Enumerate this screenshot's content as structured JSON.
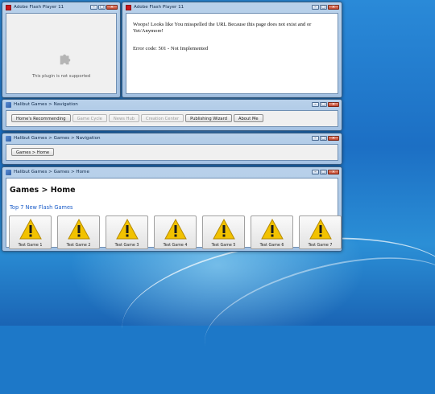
{
  "windows": {
    "flash_left": {
      "title": "Adobe Flash Player 11",
      "message": "This plugin is not supported"
    },
    "flash_right": {
      "title": "Adobe Flash Player 11",
      "message": "Woops! Looks like You misspelled the URL Because this page does not exist and or Yet/Anymore!",
      "error_code": "Error code: 501 - Not Implemented"
    },
    "navigation": {
      "title": "Halibut Games > Navigation",
      "buttons": [
        {
          "label": "Home's Recommending",
          "enabled": true
        },
        {
          "label": "Game Cycle",
          "enabled": false
        },
        {
          "label": "News Hub",
          "enabled": false
        },
        {
          "label": "Creation Center",
          "enabled": false
        },
        {
          "label": "Publishing Wizard",
          "enabled": true
        },
        {
          "label": "About Me",
          "enabled": true
        }
      ]
    },
    "games_navigation": {
      "title": "Halibut Games > Games > Navigation",
      "buttons": [
        {
          "label": "Games > Home"
        }
      ]
    },
    "games_home": {
      "title": "Halibut Games > Games > Home",
      "heading": "Games > Home",
      "subheading": "Top 7 New Flash Games",
      "games": [
        "Test Game 1",
        "Test Game 2",
        "Test Game 3",
        "Test Game 4",
        "Test Game 5",
        "Test Game 6",
        "Test Game 7"
      ]
    }
  },
  "icons": {
    "window_controls": [
      "minimize-icon",
      "maximize-icon",
      "close-icon"
    ],
    "plugin": "puzzle-piece-icon",
    "game_tile": "warning-icon"
  },
  "colors": {
    "link_blue": "#1a5cc8",
    "warning_yellow": "#f2c200",
    "flash_red": "#c9161b"
  }
}
